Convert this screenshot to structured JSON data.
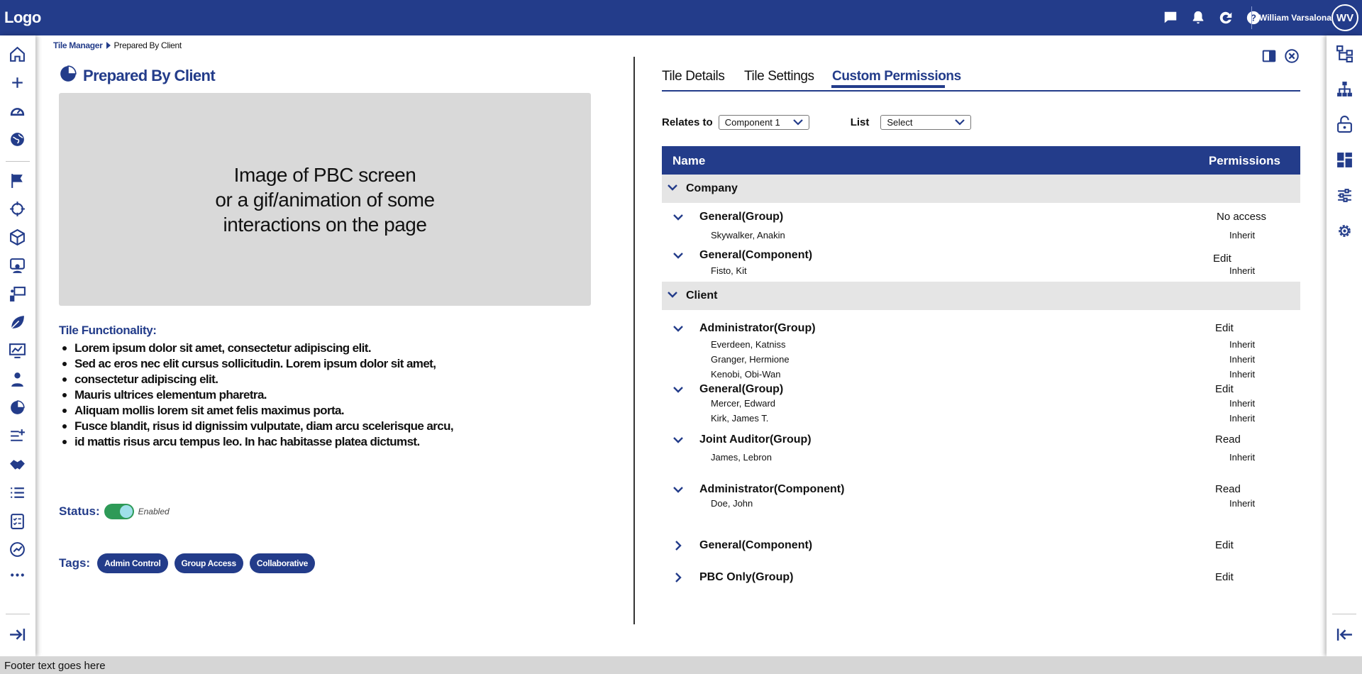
{
  "app": {
    "logo": "Logo"
  },
  "user": {
    "name": "William Varsalona",
    "initials": "WV"
  },
  "colors": {
    "brand": "#233c8a",
    "enabled": "#2e9a57",
    "section_bg": "#e5e5e5"
  },
  "top_icons": [
    "chat-icon",
    "bell-icon",
    "refresh-icon",
    "help-icon"
  ],
  "breadcrumb": {
    "parent": "Tile Manager",
    "current": "Prepared By Client"
  },
  "page": {
    "title": "Prepared By Client",
    "title_icon": "pie-chart-icon"
  },
  "preview": {
    "line1": "Image of PBC screen",
    "line2": "or a gif/animation of some",
    "line3": "interactions on the page"
  },
  "functionality": {
    "title": "Tile Functionality:",
    "items": [
      "Lorem ipsum dolor sit amet, consectetur adipiscing elit.",
      "Sed ac eros nec elit cursus sollicitudin. Lorem ipsum dolor sit amet,",
      "consectetur adipiscing elit.",
      "Mauris ultrices elementum pharetra.",
      "Aliquam mollis lorem sit amet felis maximus porta.",
      "Fusce blandit, risus id dignissim vulputate, diam arcu scelerisque arcu,",
      "id mattis risus arcu tempus leo. In hac habitasse platea dictumst."
    ]
  },
  "status": {
    "label": "Status:",
    "value": "Enabled",
    "enabled": true
  },
  "tags": {
    "label": "Tags:",
    "items": [
      "Admin Control",
      "Group Access",
      "Collaborative"
    ]
  },
  "tabs": [
    {
      "label": "Tile Details",
      "active": false
    },
    {
      "label": "Tile Settings",
      "active": false
    },
    {
      "label": "Custom Permissions",
      "active": true
    }
  ],
  "filters": {
    "relates_label": "Relates to",
    "relates_value": "Component 1",
    "list_label": "List",
    "list_value": "Select"
  },
  "table": {
    "col_name": "Name",
    "col_permissions": "Permissions",
    "sections": [
      {
        "name": "Company",
        "groups": [
          {
            "name": "General(Group)",
            "permission": "No access",
            "members": [
              {
                "name": "Skywalker, Anakin",
                "permission": "Inherit"
              }
            ]
          },
          {
            "name": "General(Component)",
            "permission": "Edit",
            "members": [
              {
                "name": "Fisto, Kit",
                "permission": "Inherit"
              }
            ]
          }
        ]
      },
      {
        "name": "Client",
        "groups": [
          {
            "name": "Administrator(Group)",
            "permission": "Edit",
            "members": [
              {
                "name": "Everdeen, Katniss",
                "permission": "Inherit"
              },
              {
                "name": "Granger, Hermione",
                "permission": "Inherit"
              },
              {
                "name": "Kenobi, Obi-Wan",
                "permission": "Inherit"
              }
            ]
          },
          {
            "name": "General(Group)",
            "permission": "Edit",
            "members": [
              {
                "name": "Mercer, Edward",
                "permission": "Inherit"
              },
              {
                "name": "Kirk, James T.",
                "permission": "Inherit"
              }
            ]
          },
          {
            "name": "Joint Auditor(Group)",
            "permission": "Read",
            "members": [
              {
                "name": "James, Lebron",
                "permission": "Inherit"
              }
            ]
          },
          {
            "name": "Administrator(Component)",
            "permission": "Read",
            "members": [
              {
                "name": "Doe, John",
                "permission": "Inherit"
              }
            ]
          },
          {
            "name": "General(Component)",
            "permission": "Edit",
            "collapsed": true,
            "members": []
          },
          {
            "name": "PBC Only(Group)",
            "permission": "Edit",
            "collapsed": true,
            "members": []
          }
        ]
      }
    ]
  },
  "footer": {
    "text": "Footer text goes here"
  }
}
